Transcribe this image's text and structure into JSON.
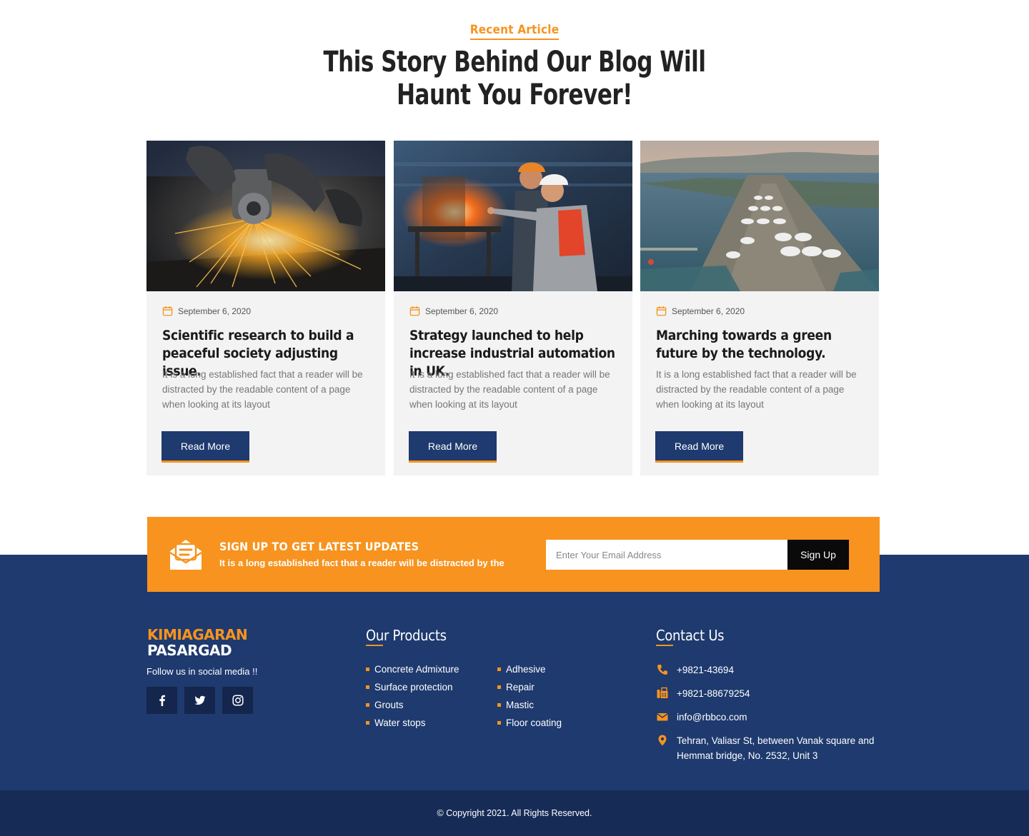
{
  "blog": {
    "eyebrow": "Recent Article",
    "headline_line1": "This Story Behind Our Blog Will",
    "headline_line2": "Haunt You Forever!",
    "cards": [
      {
        "image": "angle-grinder-sparks-photo",
        "date": "September 6, 2020",
        "title": "Scientific research to build a peaceful society adjusting issue.",
        "text": "It is a long established fact that a reader will be distracted by the readable content of a page when looking at its layout",
        "button": "Read More"
      },
      {
        "image": "factory-engineers-photo",
        "date": "September 6, 2020",
        "title": "Strategy launched to help increase industrial automation in UK.",
        "text": "It is a long established fact that a reader will be distracted by the readable content of a page when looking at its layout",
        "button": "Read More"
      },
      {
        "image": "aerial-refinery-photo",
        "date": "September 6, 2020",
        "title": "Marching towards a green future by the technology.",
        "text": "It is a long established fact that a reader will be distracted by the readable content of a page when looking at its layout",
        "button": "Read More"
      }
    ]
  },
  "newsletter": {
    "title": "SIGN UP TO GET LATEST UPDATES",
    "subtitle": "It is a long established fact that a reader will be distracted by the",
    "email_placeholder": "Enter Your Email Address",
    "button": "Sign Up"
  },
  "footer": {
    "logo_line1": "KIMIAGARAN",
    "logo_line2": "PASARGAD",
    "follow_text": "Follow us in social media !!",
    "socials": [
      "facebook-icon",
      "twitter-icon",
      "instagram-icon"
    ],
    "products_title": "Our Products",
    "products_col1": [
      "Concrete Admixture",
      "Surface protection",
      "Grouts",
      "Water stops"
    ],
    "products_col2": [
      "Adhesive",
      "Repair",
      "Mastic",
      "Floor coating"
    ],
    "contact_title": "Contact Us",
    "phone": "+9821-43694",
    "fax": "+9821-88679254",
    "email": "info@rbbco.com",
    "address": "Tehran, Valiasr St, between Vanak square and Hemmat bridge, No. 2532, Unit 3",
    "copyright": "© Copyright 2021. All Rights Reserved."
  },
  "colors": {
    "accent": "#f7931e",
    "navy": "#1e3a6e",
    "navy_dark": "#162c57",
    "card_bg": "#f3f3f3"
  }
}
